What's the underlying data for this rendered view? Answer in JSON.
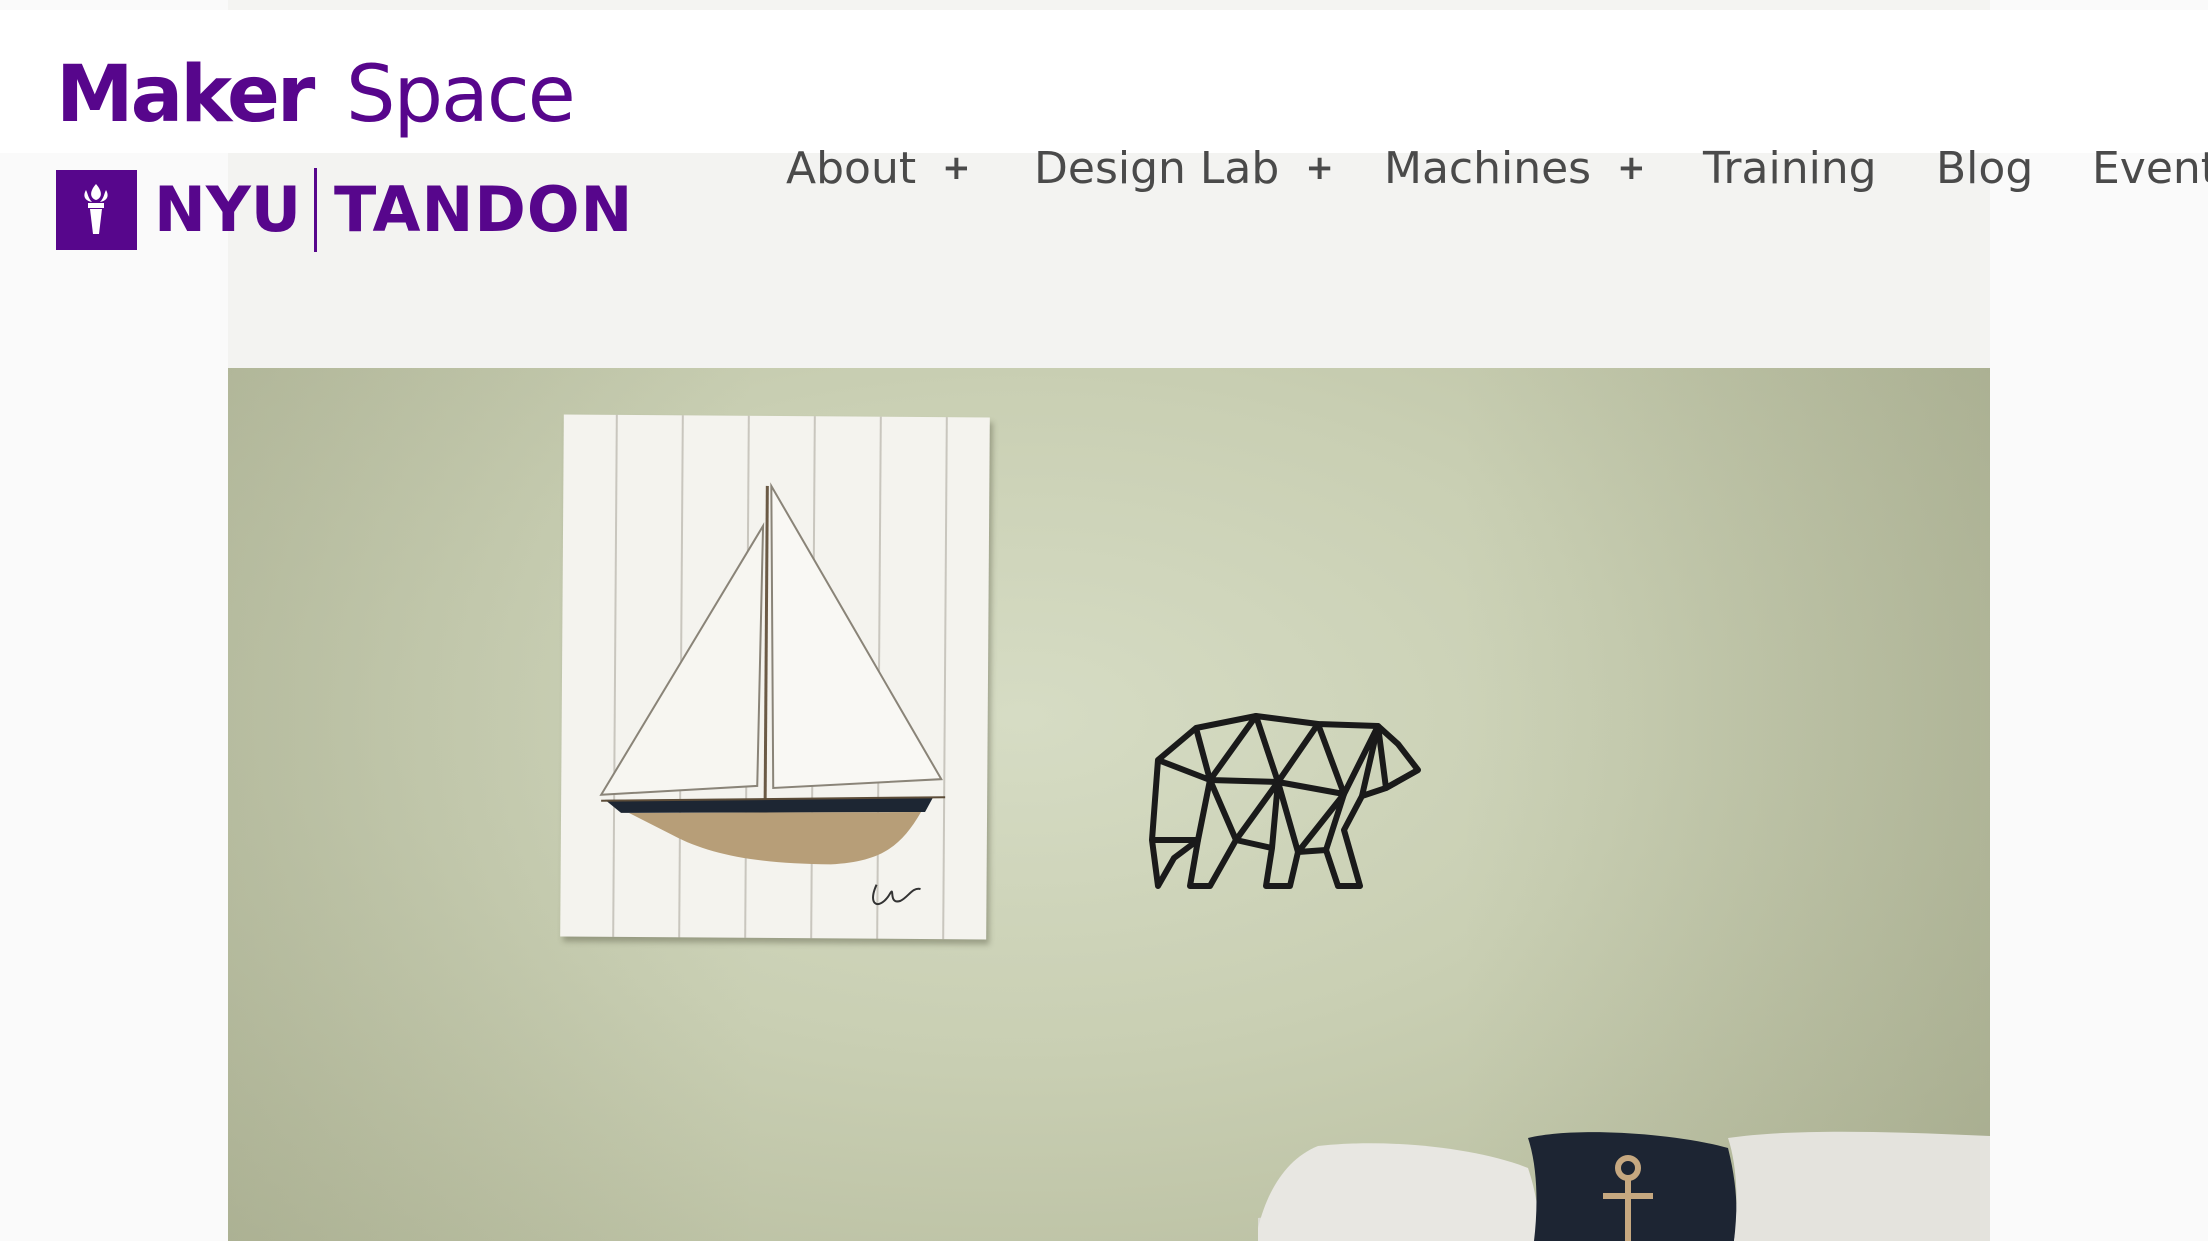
{
  "brand": {
    "maker": "Maker",
    "space": "Space",
    "nyu": "NYU",
    "tandon": "TANDON",
    "color": "#57068c"
  },
  "nav": {
    "items": [
      {
        "label": "About",
        "has_submenu": true
      },
      {
        "label": "Design Lab",
        "has_submenu": true
      },
      {
        "label": "Machines",
        "has_submenu": true
      },
      {
        "label": "Training",
        "has_submenu": false
      },
      {
        "label": "Blog",
        "has_submenu": false
      },
      {
        "label": "Event",
        "has_submenu": false
      }
    ],
    "submenu_icon": "+",
    "text_color": "#4a4a4a"
  },
  "hero": {
    "image": "photo of a sailboat painting and a geometric bear wall cutout above a bed with pillows",
    "icons": [
      "sailboat-painting",
      "geometric-bear-cutout",
      "anchor-pillow"
    ]
  }
}
